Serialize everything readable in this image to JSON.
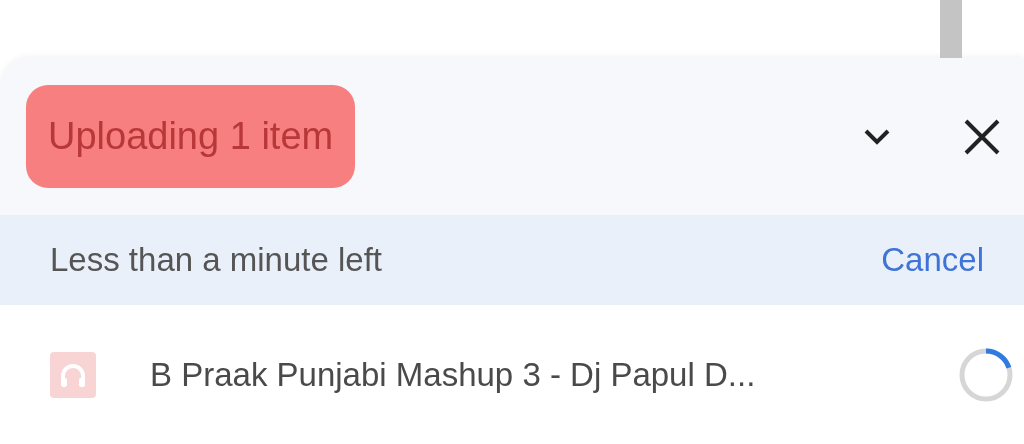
{
  "panel": {
    "title": "Uploading 1 item",
    "title_highlighted": true
  },
  "status": {
    "text": "Less than a minute left",
    "action": "Cancel"
  },
  "files": [
    {
      "name": "B Praak Punjabi Mashup 3 - Dj Papul D...",
      "level": 0.2
    }
  ]
}
